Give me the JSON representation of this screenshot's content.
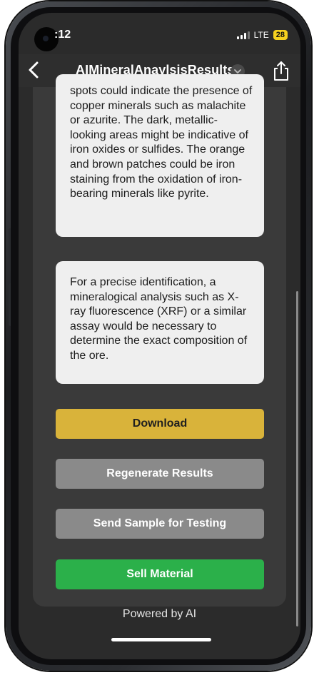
{
  "status_bar": {
    "time": ":12",
    "network": "LTE",
    "battery": "28"
  },
  "nav": {
    "title": "AIMineralAnaylsisResults"
  },
  "cards": [
    {
      "text": "spots could indicate the presence of copper minerals such as malachite or azurite. The dark, metallic-looking areas might be indicative of iron oxides or sulfides. The orange and brown patches could be iron staining from the oxidation of iron-bearing minerals like pyrite."
    },
    {
      "text": "For a precise identification, a mineralogical analysis such as X-ray fluorescence (XRF) or a similar assay would be necessary to determine the exact composition of the ore."
    }
  ],
  "buttons": {
    "download": "Download",
    "regenerate": "Regenerate Results",
    "send_sample": "Send Sample for Testing",
    "sell": "Sell Material"
  },
  "footer": {
    "powered_by": "Powered by AI"
  },
  "colors": {
    "download": "#d9b33a",
    "secondary": "#8a8a8a",
    "sell": "#2bb04a",
    "battery": "#f6d21f"
  },
  "icons": [
    "back-chevron-icon",
    "chevron-down-icon",
    "share-icon",
    "signal-icon",
    "battery-icon"
  ]
}
